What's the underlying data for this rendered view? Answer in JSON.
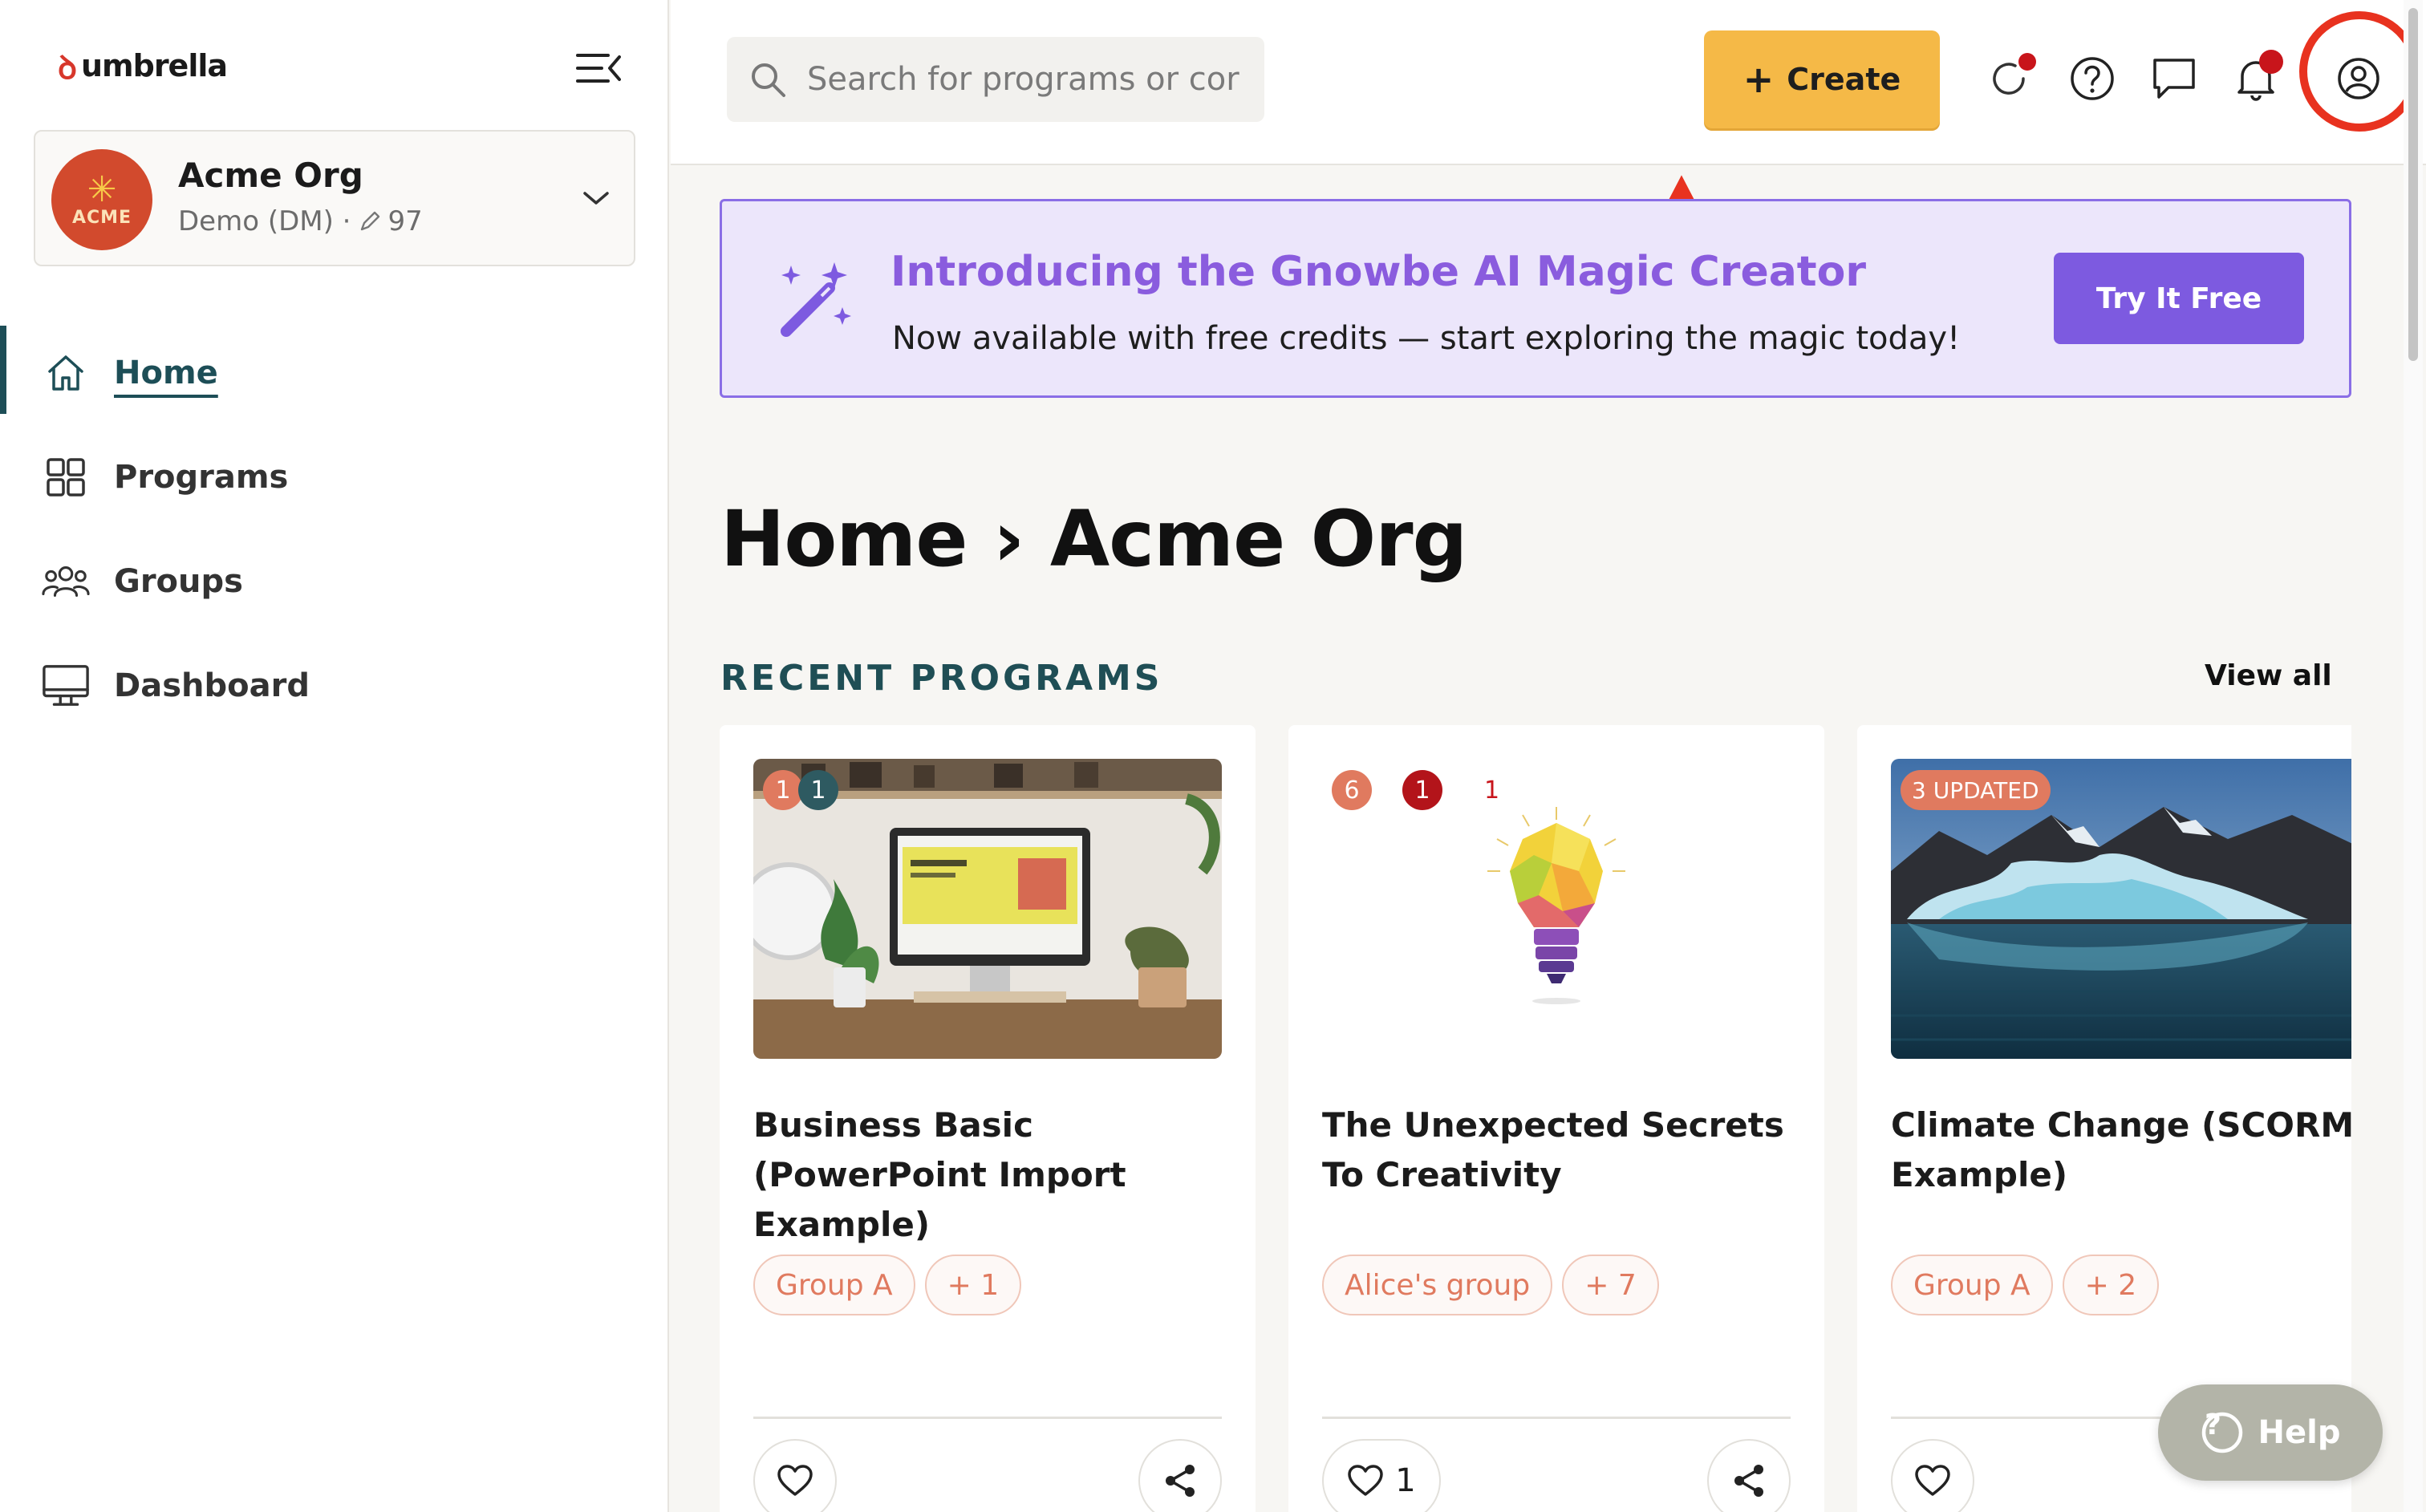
{
  "app": {
    "logo_text": "umbrella",
    "logo_mark": "ꝺ"
  },
  "org": {
    "name": "Acme Org",
    "subtitle": "Demo (DM) ·",
    "count": "97",
    "avatar_text": "ACME",
    "avatar_symbol": "✳"
  },
  "sidebar": {
    "items": [
      {
        "label": "Home",
        "icon": "home-icon",
        "active": true
      },
      {
        "label": "Programs",
        "icon": "grid-icon",
        "active": false
      },
      {
        "label": "Groups",
        "icon": "users-icon",
        "active": false
      },
      {
        "label": "Dashboard",
        "icon": "monitor-icon",
        "active": false
      }
    ]
  },
  "topbar": {
    "search_placeholder": "Search for programs or cor",
    "create_label": "Create",
    "create_symbol": "+",
    "icons": [
      "refresh-icon",
      "help-circle-icon",
      "chat-icon",
      "bell-icon",
      "account-icon"
    ]
  },
  "banner": {
    "title": "Introducing the Gnowbe AI Magic Creator",
    "text": "Now available with free credits — start exploring the magic today!",
    "button": "Try It Free"
  },
  "main": {
    "title": "Home › Acme Org",
    "section": "RECENT PROGRAMS",
    "view_all": "View all"
  },
  "programs": [
    {
      "title": "Business Basic (PowerPoint Import Example)",
      "badges": [
        "1",
        "1"
      ],
      "chips": [
        "Group A",
        "+ 1"
      ],
      "likes": ""
    },
    {
      "title": "The Unexpected Secrets To Creativity",
      "badges": [
        "6",
        "1",
        "1"
      ],
      "chips": [
        "Alice's group",
        "+ 7"
      ],
      "likes": "1"
    },
    {
      "title": "Climate Change (SCORM Example)",
      "badges": [
        "3 UPDATED"
      ],
      "chips": [
        "Group A",
        "+ 2"
      ],
      "likes": ""
    }
  ],
  "help": {
    "label": "Help",
    "symbol": "?"
  },
  "colors": {
    "accent_teal": "#1d4e57",
    "create_yellow": "#f5b947",
    "banner_purple": "#7d5ae0",
    "badge_orange": "#e07a5f",
    "badge_red": "#b3141a",
    "badge_teal": "#2e5a61",
    "highlight_red": "#e8321f"
  }
}
